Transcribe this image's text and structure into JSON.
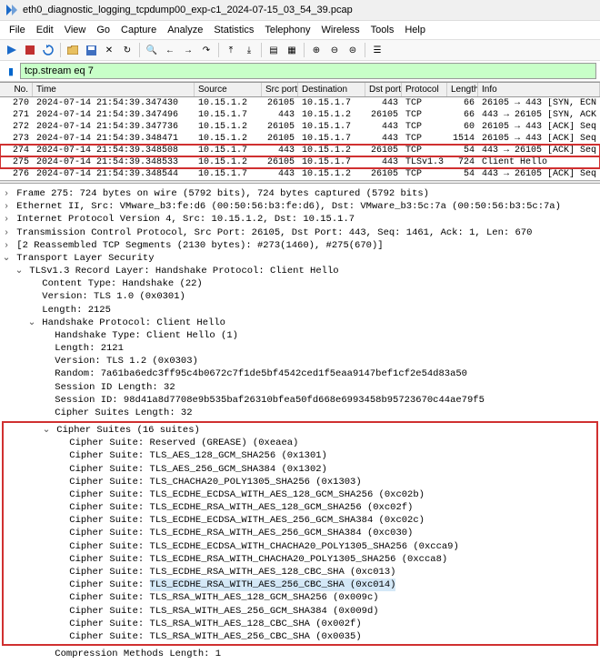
{
  "window": {
    "title": "eth0_diagnostic_logging_tcpdump00_exp-c1_2024-07-15_03_54_39.pcap"
  },
  "menus": [
    "File",
    "Edit",
    "View",
    "Go",
    "Capture",
    "Analyze",
    "Statistics",
    "Telephony",
    "Wireless",
    "Tools",
    "Help"
  ],
  "filter": {
    "value": "tcp.stream eq 7"
  },
  "columns": {
    "no": "No.",
    "time": "Time",
    "src": "Source",
    "sport": "Src port",
    "dst": "Destination",
    "dport": "Dst port",
    "proto": "Protocol",
    "len": "Length",
    "info": "Info"
  },
  "packets": [
    {
      "no": "270",
      "time": "2024-07-14 21:54:39.347430",
      "src": "10.15.1.2",
      "sport": "26105",
      "dst": "10.15.1.7",
      "dport": "443",
      "proto": "TCP",
      "len": "66",
      "info": "26105 → 443 [SYN, ECN"
    },
    {
      "no": "271",
      "time": "2024-07-14 21:54:39.347496",
      "src": "10.15.1.7",
      "sport": "443",
      "dst": "10.15.1.2",
      "dport": "26105",
      "proto": "TCP",
      "len": "66",
      "info": "443 → 26105 [SYN, ACK"
    },
    {
      "no": "272",
      "time": "2024-07-14 21:54:39.347736",
      "src": "10.15.1.2",
      "sport": "26105",
      "dst": "10.15.1.7",
      "dport": "443",
      "proto": "TCP",
      "len": "60",
      "info": "26105 → 443 [ACK] Seq"
    },
    {
      "no": "273",
      "time": "2024-07-14 21:54:39.348471",
      "src": "10.15.1.2",
      "sport": "26105",
      "dst": "10.15.1.7",
      "dport": "443",
      "proto": "TCP",
      "len": "1514",
      "info": "26105 → 443 [ACK] Seq"
    },
    {
      "no": "274",
      "time": "2024-07-14 21:54:39.348508",
      "src": "10.15.1.7",
      "sport": "443",
      "dst": "10.15.1.2",
      "dport": "26105",
      "proto": "TCP",
      "len": "54",
      "info": "443 → 26105 [ACK] Seq",
      "hl": true
    },
    {
      "no": "275",
      "time": "2024-07-14 21:54:39.348533",
      "src": "10.15.1.2",
      "sport": "26105",
      "dst": "10.15.1.7",
      "dport": "443",
      "proto": "TLSv1.3",
      "len": "724",
      "info": "Client Hello",
      "sel": true
    },
    {
      "no": "276",
      "time": "2024-07-14 21:54:39.348544",
      "src": "10.15.1.7",
      "sport": "443",
      "dst": "10.15.1.2",
      "dport": "26105",
      "proto": "TCP",
      "len": "54",
      "info": "443 → 26105 [ACK] Seq"
    }
  ],
  "details": {
    "summary": [
      {
        "t": ">",
        "i": 0,
        "txt": "Frame 275: 724 bytes on wire (5792 bits), 724 bytes captured (5792 bits)"
      },
      {
        "t": ">",
        "i": 0,
        "txt": "Ethernet II, Src: VMware_b3:fe:d6 (00:50:56:b3:fe:d6), Dst: VMware_b3:5c:7a (00:50:56:b3:5c:7a)"
      },
      {
        "t": ">",
        "i": 0,
        "txt": "Internet Protocol Version 4, Src: 10.15.1.2, Dst: 10.15.1.7"
      },
      {
        "t": ">",
        "i": 0,
        "txt": "Transmission Control Protocol, Src Port: 26105, Dst Port: 443, Seq: 1461, Ack: 1, Len: 670"
      },
      {
        "t": ">",
        "i": 0,
        "txt": "[2 Reassembled TCP Segments (2130 bytes): #273(1460), #275(670)]"
      },
      {
        "t": "v",
        "i": 0,
        "txt": "Transport Layer Security"
      },
      {
        "t": "v",
        "i": 1,
        "txt": "TLSv1.3 Record Layer: Handshake Protocol: Client Hello"
      },
      {
        "t": " ",
        "i": 2,
        "txt": "Content Type: Handshake (22)"
      },
      {
        "t": " ",
        "i": 2,
        "txt": "Version: TLS 1.0 (0x0301)"
      },
      {
        "t": " ",
        "i": 2,
        "txt": "Length: 2125"
      },
      {
        "t": "v",
        "i": 2,
        "txt": "Handshake Protocol: Client Hello"
      },
      {
        "t": " ",
        "i": 3,
        "txt": "Handshake Type: Client Hello (1)"
      },
      {
        "t": " ",
        "i": 3,
        "txt": "Length: 2121"
      },
      {
        "t": " ",
        "i": 3,
        "txt": "Version: TLS 1.2 (0x0303)"
      },
      {
        "t": " ",
        "i": 3,
        "txt": "Random: 7a61ba6edc3ff95c4b0672c7f1de5bf4542ced1f5eaa9147bef1cf2e54d83a50"
      },
      {
        "t": " ",
        "i": 3,
        "txt": "Session ID Length: 32"
      },
      {
        "t": " ",
        "i": 3,
        "txt": "Session ID: 98d41a8d7708e9b535baf26310bfea50fd668e6993458b95723670c44ae79f5"
      },
      {
        "t": " ",
        "i": 3,
        "txt": "Cipher Suites Length: 32"
      }
    ],
    "cipher_header": {
      "t": "v",
      "i": 3,
      "txt": "Cipher Suites (16 suites)"
    },
    "ciphers": [
      "Cipher Suite: Reserved (GREASE) (0xeaea)",
      "Cipher Suite: TLS_AES_128_GCM_SHA256 (0x1301)",
      "Cipher Suite: TLS_AES_256_GCM_SHA384 (0x1302)",
      "Cipher Suite: TLS_CHACHA20_POLY1305_SHA256 (0x1303)",
      "Cipher Suite: TLS_ECDHE_ECDSA_WITH_AES_128_GCM_SHA256 (0xc02b)",
      "Cipher Suite: TLS_ECDHE_RSA_WITH_AES_128_GCM_SHA256 (0xc02f)",
      "Cipher Suite: TLS_ECDHE_ECDSA_WITH_AES_256_GCM_SHA384 (0xc02c)",
      "Cipher Suite: TLS_ECDHE_RSA_WITH_AES_256_GCM_SHA384 (0xc030)",
      "Cipher Suite: TLS_ECDHE_ECDSA_WITH_CHACHA20_POLY1305_SHA256 (0xcca9)",
      "Cipher Suite: TLS_ECDHE_RSA_WITH_CHACHA20_POLY1305_SHA256 (0xcca8)",
      "Cipher Suite: TLS_ECDHE_RSA_WITH_AES_128_CBC_SHA (0xc013)",
      "Cipher Suite: TLS_ECDHE_RSA_WITH_AES_256_CBC_SHA (0xc014)",
      "Cipher Suite: TLS_RSA_WITH_AES_128_GCM_SHA256 (0x009c)",
      "Cipher Suite: TLS_RSA_WITH_AES_256_GCM_SHA384 (0x009d)",
      "Cipher Suite: TLS_RSA_WITH_AES_128_CBC_SHA (0x002f)",
      "Cipher Suite: TLS_RSA_WITH_AES_256_CBC_SHA (0x0035)"
    ],
    "after": [
      {
        "t": " ",
        "i": 3,
        "txt": "Compression Methods Length: 1"
      }
    ]
  }
}
